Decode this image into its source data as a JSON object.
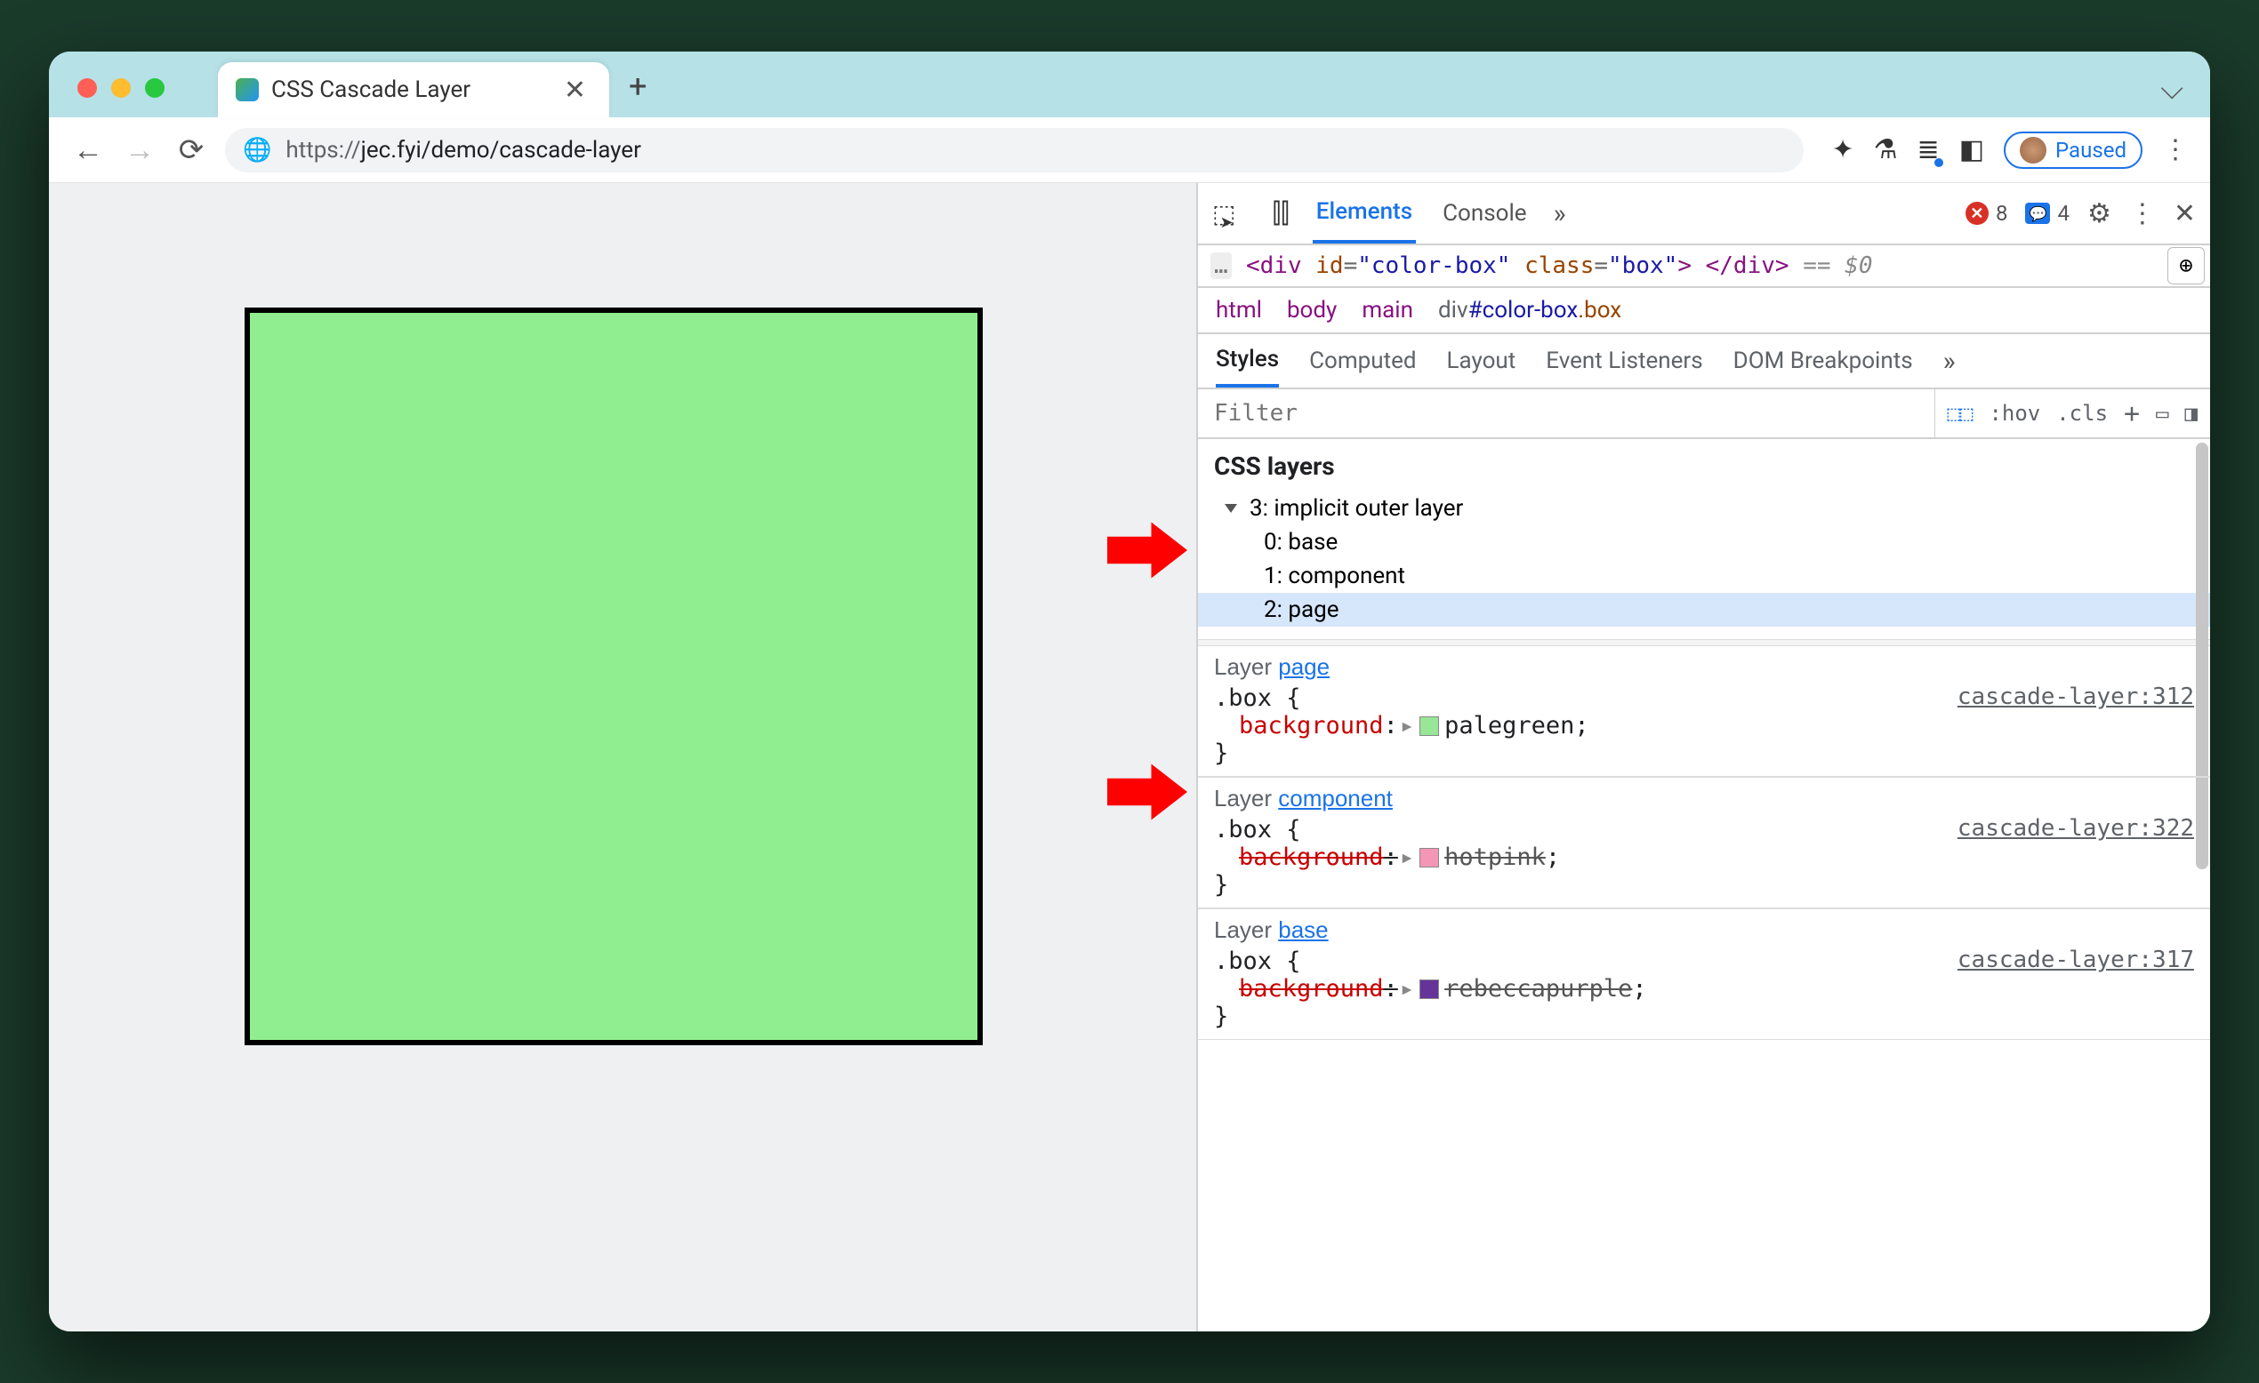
{
  "tab": {
    "title": "CSS Cascade Layer"
  },
  "omnibox": {
    "url_proto": "https://",
    "url_rest": "jec.fyi/demo/cascade-layer"
  },
  "pause": {
    "label": "Paused"
  },
  "devtools": {
    "tabs": {
      "elements": "Elements",
      "console": "Console"
    },
    "errors": "8",
    "messages": "4",
    "dom_line_pre": "<div ",
    "dom_id_attr": "id",
    "dom_id_val": "\"color-box\"",
    "dom_class_attr": "class",
    "dom_class_val": "\"box\"",
    "dom_line_post": "> </div>",
    "dom_dollar": " == $0",
    "breadcrumb": {
      "html": "html",
      "body": "body",
      "main": "main",
      "leaf_tag": "div",
      "leaf_id": "#color-box",
      "leaf_cls": ".box"
    },
    "subtabs": {
      "styles": "Styles",
      "computed": "Computed",
      "layout": "Layout",
      "listeners": "Event Listeners",
      "dom_bp": "DOM Breakpoints"
    },
    "filter_placeholder": "Filter",
    "filter_tools": {
      "hov": ":hov",
      "cls": ".cls",
      "plus": "+"
    },
    "layers_title": "CSS layers",
    "layers_root": "3: implicit outer layer",
    "layers_items": [
      "0: base",
      "1: component",
      "2: page"
    ],
    "rules": [
      {
        "layer_prefix": "Layer ",
        "layer_link": "page",
        "selector": ".box {",
        "prop": "background",
        "value": "palegreen",
        "swatch": "#98e698",
        "src": "cascade-layer:312",
        "struck": false
      },
      {
        "layer_prefix": "Layer ",
        "layer_link": "component",
        "selector": ".box {",
        "prop": "background",
        "value": "hotpink",
        "swatch": "#f497b6",
        "src": "cascade-layer:322",
        "struck": true
      },
      {
        "layer_prefix": "Layer ",
        "layer_link": "base",
        "selector": ".box {",
        "prop": "background",
        "value": "rebeccapurple",
        "swatch": "#663399",
        "src": "cascade-layer:317",
        "struck": true
      }
    ]
  }
}
